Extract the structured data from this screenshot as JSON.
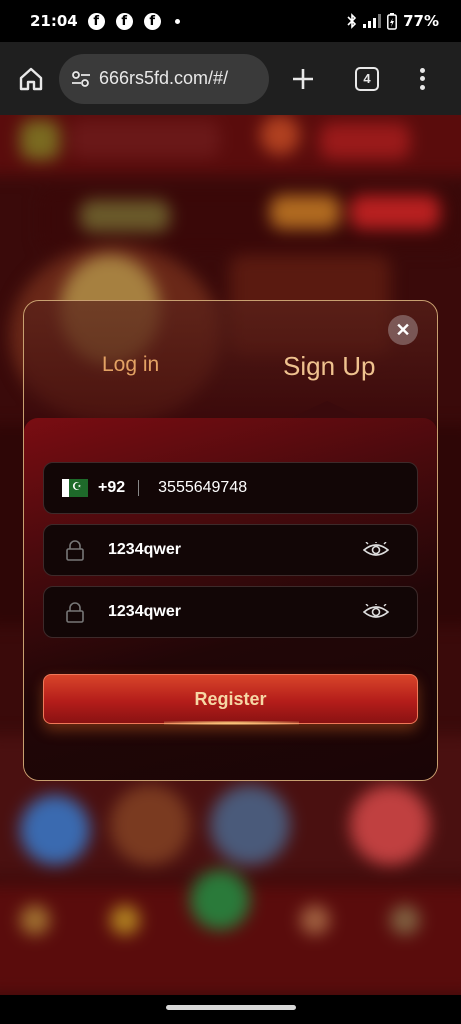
{
  "status_bar": {
    "time": "21:04",
    "notification_icons": [
      "facebook-icon",
      "facebook-icon",
      "facebook-icon"
    ],
    "battery": "77%"
  },
  "browser": {
    "url": "666rs5fd.com/#/",
    "tab_count": "4"
  },
  "modal": {
    "tabs": {
      "login": "Log in",
      "signup": "Sign Up"
    },
    "active_tab": "signup",
    "close_glyph": "✕",
    "phone": {
      "country_flag": "pakistan-flag-icon",
      "country_code": "+92",
      "value": "3555649748"
    },
    "password": {
      "value": "1234qwer"
    },
    "confirm_password": {
      "value": "1234qwer"
    },
    "register_label": "Register"
  },
  "colors": {
    "accent_gold": "#efc28f",
    "button_red": "#b41d1a",
    "panel_dark": "#1a0506"
  }
}
